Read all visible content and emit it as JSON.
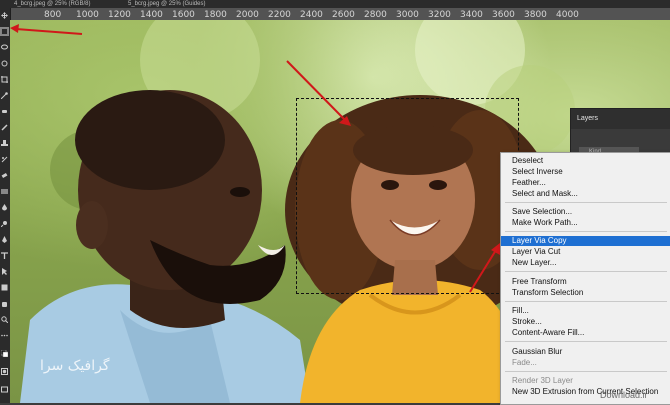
{
  "tabs": {
    "tab1": "4_bcrg.jpeg @ 25% (RGB/8)",
    "tab2": "5_bcrg.jpeg @ 25% (Guides)"
  },
  "ruler": {
    "ticks": [
      "800",
      "1000",
      "1200",
      "1400",
      "1600",
      "1800",
      "2000",
      "2200",
      "2400",
      "2600",
      "2800",
      "3000",
      "3200",
      "3400",
      "3600",
      "3800",
      "4000"
    ]
  },
  "layers_panel": {
    "title": "Layers",
    "kind_label": "Kind"
  },
  "context_menu": {
    "items": [
      {
        "label": "Deselect"
      },
      {
        "label": "Select Inverse"
      },
      {
        "label": "Feather..."
      },
      {
        "label": "Select and Mask..."
      },
      {
        "label": "Save Selection..."
      },
      {
        "label": "Make Work Path..."
      },
      {
        "label": "Layer Via Copy"
      },
      {
        "label": "Layer Via Cut"
      },
      {
        "label": "New Layer..."
      },
      {
        "label": "Free Transform"
      },
      {
        "label": "Transform Selection"
      },
      {
        "label": "Fill..."
      },
      {
        "label": "Stroke..."
      },
      {
        "label": "Content-Aware Fill..."
      },
      {
        "label": "Gaussian Blur"
      },
      {
        "label": "Fade..."
      },
      {
        "label": "Render 3D Layer"
      },
      {
        "label": "New 3D Extrusion from Current Selection"
      }
    ]
  },
  "watermark": {
    "left_text": "گرافیک سرا",
    "right_text": "Download.ir"
  },
  "colors": {
    "highlight": "#1e6fd2",
    "arrow": "#d0181a"
  }
}
